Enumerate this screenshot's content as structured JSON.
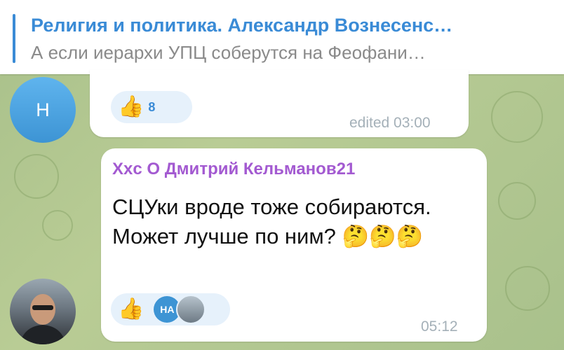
{
  "pinned": {
    "title": "Религия и политика. Александр Вознесенс…",
    "snippet": "А если иерархи УПЦ соберутся на Феофани…"
  },
  "message1": {
    "avatar_initial": "Н",
    "reaction_icon": "thumbs-up-icon",
    "reaction_emoji": "👍",
    "reaction_count": "8",
    "time": "edited 03:00"
  },
  "message2": {
    "sender": "Xxc O Дмитрий Кельманов21",
    "text": "СЦУки вроде тоже собираются. Может лучше по ним? 🤔🤔🤔",
    "reaction_icon": "thumbs-up-icon",
    "reaction_emoji": "👍",
    "reactor_initials": "НА",
    "time": "05:12"
  },
  "colors": {
    "accent": "#3a8bd6",
    "sender_name": "#a35ad1",
    "avatar_blue": "#4aa3e3"
  }
}
